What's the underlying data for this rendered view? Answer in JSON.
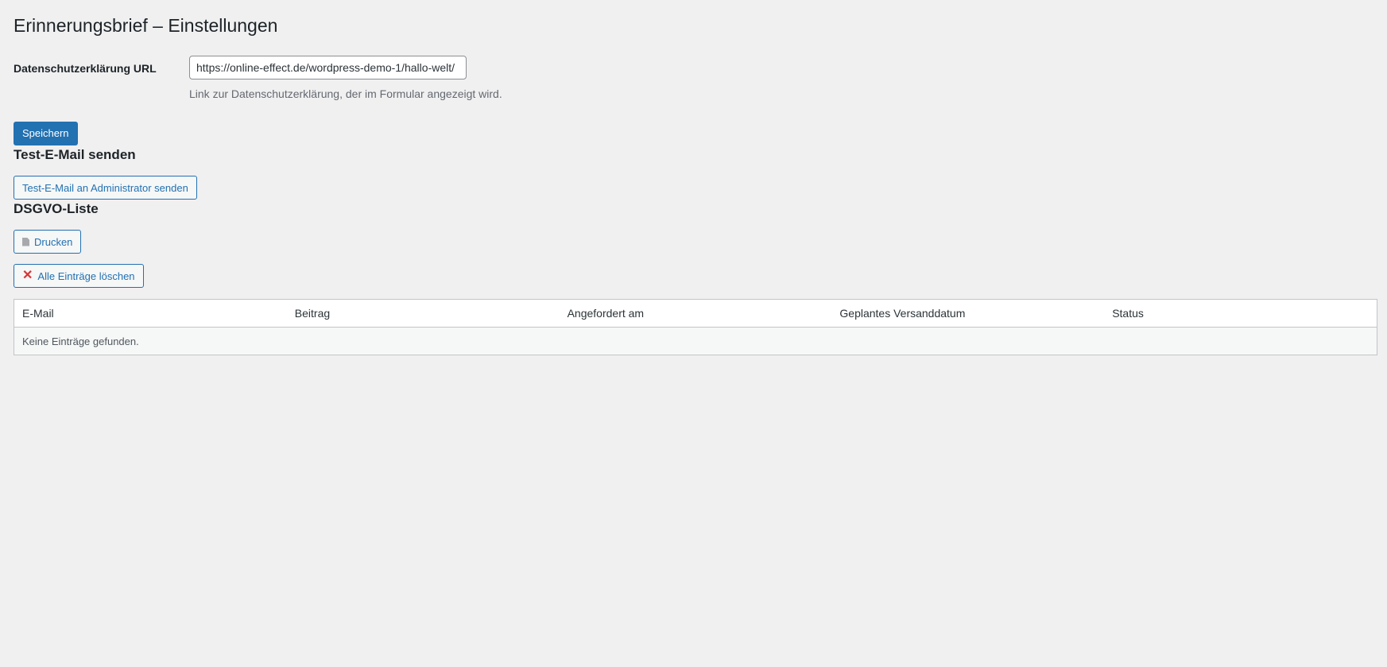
{
  "page": {
    "title": "Erinnerungsbrief – Einstellungen"
  },
  "settings": {
    "privacy_label": "Datenschutzerklärung URL",
    "privacy_url_value": "https://online-effect.de/wordpress-demo-1/hallo-welt/",
    "privacy_description": "Link zur Datenschutzerklärung, der im Formular angezeigt wird.",
    "save_label": "Speichern"
  },
  "test_email": {
    "heading": "Test-E-Mail senden",
    "button_label": "Test-E-Mail an Administrator senden"
  },
  "dsgvo": {
    "heading": "DSGVO-Liste",
    "print_label": "Drucken",
    "print_icon": "document-icon",
    "delete_label": "Alle Einträge löschen",
    "delete_icon": "close-icon",
    "delete_icon_color": "#d63638",
    "columns": [
      "E-Mail",
      "Beitrag",
      "Angefordert am",
      "Geplantes Versanddatum",
      "Status"
    ],
    "empty_message": "Keine Einträge gefunden."
  },
  "colors": {
    "accent": "#2271b1",
    "background": "#f0f0f1"
  }
}
